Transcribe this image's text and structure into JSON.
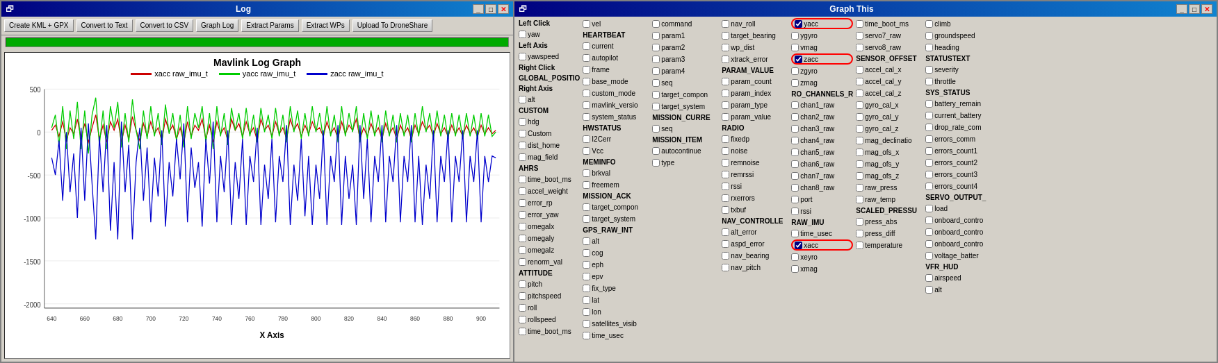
{
  "left_window": {
    "title": "Log",
    "toolbar_buttons": [
      "Create KML + GPX",
      "Convert to Text",
      "Convert to CSV",
      "Graph Log",
      "Extract Params",
      "Extract WPs",
      "Upload To DroneShare"
    ],
    "graph_title": "Mavlink Log Graph",
    "legend": [
      {
        "label": "xacc raw_imu_t",
        "color": "#cc0000"
      },
      {
        "label": "yacc raw_imu_t",
        "color": "#00cc00"
      },
      {
        "label": "zacc raw_imu_t",
        "color": "#0000cc"
      }
    ],
    "y_axis": [
      "500",
      "0",
      "-500",
      "-1000",
      "-1500",
      "-2000"
    ],
    "x_axis": [
      "640",
      "660",
      "680",
      "700",
      "720",
      "740",
      "760",
      "780",
      "800",
      "820",
      "840",
      "860",
      "880",
      "900"
    ],
    "x_label": "X Axis",
    "controls": {
      "minimize": "_",
      "maximize": "□",
      "close": "✕"
    }
  },
  "right_window": {
    "title": "Graph This",
    "controls": {
      "minimize": "_",
      "maximize": "□",
      "close": "✕"
    },
    "row_labels": {
      "left_click": "Left Click",
      "left_axis": "Left Axis",
      "right_click": "Right Click",
      "right_axis": "Right Axis",
      "custom": "CUSTOM",
      "ahrs": "AHRS",
      "attitude": "ATTITUDE",
      "nav_controller": "NAV_CONTROLLE",
      "raw_imu": "RAW_IMU"
    },
    "columns": [
      {
        "header": "",
        "items": [
          {
            "label": "Left Click",
            "header": true
          },
          {
            "label": "yaw",
            "checked": false
          },
          {
            "label": "Left Axis",
            "header": true
          },
          {
            "label": "yawspeed",
            "checked": false
          },
          {
            "label": "Right Click",
            "header": true
          },
          {
            "label": "GLOBAL_POSITIO",
            "header": true
          },
          {
            "label": "Right Axis",
            "header": true
          },
          {
            "label": "alt",
            "checked": false
          },
          {
            "label": "CUSTOM",
            "header": true
          },
          {
            "label": "hdg",
            "checked": false
          },
          {
            "label": "Custom",
            "checked": false
          },
          {
            "label": "dist_home",
            "checked": false
          },
          {
            "label": "mag_field",
            "checked": false
          },
          {
            "label": "AHRS",
            "header": true
          },
          {
            "label": "time_boot_ms",
            "checked": false
          },
          {
            "label": "accel_weight",
            "checked": false
          },
          {
            "label": "error_rp",
            "checked": false
          },
          {
            "label": "error_yaw",
            "checked": false
          },
          {
            "label": "omegaIx",
            "checked": false
          },
          {
            "label": "omegaIy",
            "checked": false
          },
          {
            "label": "omegaIz",
            "checked": false
          },
          {
            "label": "renorm_val",
            "checked": false
          },
          {
            "label": "ATTITUDE",
            "header": true
          },
          {
            "label": "pitch",
            "checked": false
          },
          {
            "label": "pitchspeed",
            "checked": false
          },
          {
            "label": "roll",
            "checked": false
          },
          {
            "label": "rollspeed",
            "checked": false
          },
          {
            "label": "time_boot_ms",
            "checked": false
          }
        ]
      },
      {
        "header": "",
        "items": [
          {
            "label": "vel",
            "checked": false
          },
          {
            "label": "HEARTBEAT",
            "header": true
          },
          {
            "label": "current",
            "checked": false
          },
          {
            "label": "autopilot",
            "checked": false
          },
          {
            "label": "frame",
            "checked": false
          },
          {
            "label": "base_mode",
            "checked": false
          },
          {
            "label": "custom_mode",
            "checked": false
          },
          {
            "label": "mavlink_versio",
            "checked": false
          },
          {
            "label": "system_status",
            "checked": false
          },
          {
            "label": "HWSTATUS",
            "header": true
          },
          {
            "label": "I2Cerr",
            "checked": false
          },
          {
            "label": "Vcc",
            "checked": false
          },
          {
            "label": "MEMINFO",
            "header": true
          },
          {
            "label": "brkval",
            "checked": false
          },
          {
            "label": "freemem",
            "checked": false
          },
          {
            "label": "MISSION_ACK",
            "header": true
          },
          {
            "label": "target_compon",
            "checked": false
          },
          {
            "label": "target_system",
            "checked": false
          },
          {
            "label": "GPS_RAW_INT",
            "header": true
          },
          {
            "label": "alt",
            "checked": false
          },
          {
            "label": "cog",
            "checked": false
          },
          {
            "label": "eph",
            "checked": false
          },
          {
            "label": "epv",
            "checked": false
          },
          {
            "label": "fix_type",
            "checked": false
          },
          {
            "label": "lat",
            "checked": false
          },
          {
            "label": "lon",
            "checked": false
          },
          {
            "label": "satellites_visib",
            "checked": false
          },
          {
            "label": "time_usec",
            "checked": false
          }
        ]
      },
      {
        "header": "",
        "items": [
          {
            "label": "command",
            "checked": false
          },
          {
            "label": "param1",
            "checked": false
          },
          {
            "label": "param2",
            "checked": false
          },
          {
            "label": "param3",
            "checked": false
          },
          {
            "label": "param4",
            "checked": false
          },
          {
            "label": "seq",
            "checked": false
          },
          {
            "label": "target_compon",
            "checked": false
          },
          {
            "label": "target_system",
            "checked": false
          },
          {
            "label": "MISSION_CURRE",
            "header": true
          },
          {
            "label": "seq",
            "checked": false
          },
          {
            "label": "MISSION_ITEM",
            "header": true
          },
          {
            "label": "autocontinue",
            "checked": false
          },
          {
            "label": "type",
            "checked": false
          }
        ]
      },
      {
        "header": "",
        "items": [
          {
            "label": "nav_roll",
            "checked": false
          },
          {
            "label": "target_bearing",
            "checked": false
          },
          {
            "label": "wp_dist",
            "checked": false
          },
          {
            "label": "xtrack_error",
            "checked": false
          },
          {
            "label": "PARAM_VALUE",
            "header": true
          },
          {
            "label": "param_count",
            "checked": false
          },
          {
            "label": "param_index",
            "checked": false
          },
          {
            "label": "param_type",
            "checked": false
          },
          {
            "label": "param_value",
            "checked": false
          },
          {
            "label": "RADIO",
            "header": true
          },
          {
            "label": "fixedp",
            "checked": false
          },
          {
            "label": "noise",
            "checked": false
          },
          {
            "label": "remnoise",
            "checked": false
          },
          {
            "label": "remrssi",
            "checked": false
          },
          {
            "label": "rssi",
            "checked": false
          },
          {
            "label": "rxerrors",
            "checked": false
          },
          {
            "label": "txbuf",
            "checked": false
          },
          {
            "label": "NAV_CONTROLLE",
            "header": true
          },
          {
            "label": "alt_error",
            "checked": false
          },
          {
            "label": "aspd_error",
            "checked": false
          },
          {
            "label": "nav_bearing",
            "checked": false
          },
          {
            "label": "nav_pitch",
            "checked": false
          }
        ]
      },
      {
        "header": "",
        "items": [
          {
            "label": "yacc",
            "checked": true,
            "highlighted": true
          },
          {
            "label": "ygyro",
            "checked": false
          },
          {
            "label": "vmag",
            "checked": false
          },
          {
            "label": "zacc",
            "checked": true,
            "highlighted": true
          },
          {
            "label": "zgyro",
            "checked": false
          },
          {
            "label": "zmag",
            "checked": false
          },
          {
            "label": "RO_CHANNELS_R",
            "header": true
          },
          {
            "label": "chan1_raw",
            "checked": false
          },
          {
            "label": "chan2_raw",
            "checked": false
          },
          {
            "label": "chan3_raw",
            "checked": false
          },
          {
            "label": "chan4_raw",
            "checked": false
          },
          {
            "label": "chan5_raw",
            "checked": false
          },
          {
            "label": "chan6_raw",
            "checked": false
          },
          {
            "label": "chan7_raw",
            "checked": false
          },
          {
            "label": "chan8_raw",
            "checked": false
          },
          {
            "label": "port",
            "checked": false
          },
          {
            "label": "rssi",
            "checked": false
          },
          {
            "label": "RAW_IMU",
            "header": true
          },
          {
            "label": "time_usec",
            "checked": false
          },
          {
            "label": "xacc",
            "checked": true,
            "highlighted": true
          },
          {
            "label": "xeyro",
            "checked": false
          },
          {
            "label": "xmag",
            "checked": false
          }
        ]
      },
      {
        "header": "",
        "items": [
          {
            "label": "time_boot_ms",
            "checked": false
          },
          {
            "label": "servo7_raw",
            "checked": false
          },
          {
            "label": "servo8_raw",
            "checked": false
          },
          {
            "label": "SENSOR_OFFSET",
            "header": true
          },
          {
            "label": "accel_cal_x",
            "checked": false
          },
          {
            "label": "accel_cal_y",
            "checked": false
          },
          {
            "label": "accel_cal_z",
            "checked": false
          },
          {
            "label": "gyro_cal_x",
            "checked": false
          },
          {
            "label": "gyro_cal_y",
            "checked": false
          },
          {
            "label": "gyro_cal_z",
            "checked": false
          },
          {
            "label": "mag_declinatio",
            "checked": false
          },
          {
            "label": "mag_ofs_x",
            "checked": false
          },
          {
            "label": "mag_ofs_y",
            "checked": false
          },
          {
            "label": "mag_ofs_z",
            "checked": false
          },
          {
            "label": "raw_press",
            "checked": false
          },
          {
            "label": "raw_temp",
            "checked": false
          },
          {
            "label": "SCALED_PRESSU",
            "header": true
          },
          {
            "label": "press_abs",
            "checked": false
          },
          {
            "label": "press_diff",
            "checked": false
          },
          {
            "label": "temperature",
            "checked": false
          }
        ]
      },
      {
        "header": "",
        "items": [
          {
            "label": "climb",
            "checked": false
          },
          {
            "label": "groundspeed",
            "checked": false
          },
          {
            "label": "heading",
            "checked": false
          },
          {
            "label": "STATUSTEXT",
            "header": true
          },
          {
            "label": "severity",
            "checked": false
          },
          {
            "label": "throttle",
            "checked": false
          },
          {
            "label": "SYS_STATUS",
            "header": true
          },
          {
            "label": "battery_remain",
            "checked": false
          },
          {
            "label": "current_battery",
            "checked": false
          },
          {
            "label": "drop_rate_com",
            "checked": false
          },
          {
            "label": "errors_comm",
            "checked": false
          },
          {
            "label": "errors_count1",
            "checked": false
          },
          {
            "label": "errors_count2",
            "checked": false
          },
          {
            "label": "errors_count3",
            "checked": false
          },
          {
            "label": "errors_count4",
            "checked": false
          },
          {
            "label": "SERVO_OUTPUT_",
            "header": true
          },
          {
            "label": "load",
            "checked": false
          },
          {
            "label": "onboard_contro",
            "checked": false
          },
          {
            "label": "onboard_contro",
            "checked": false
          },
          {
            "label": "onboard_contro",
            "checked": false
          },
          {
            "label": "voltage_batter",
            "checked": false
          },
          {
            "label": "VFR_HUD",
            "header": true
          },
          {
            "label": "airspeed",
            "checked": false
          },
          {
            "label": "alt",
            "checked": false
          }
        ]
      }
    ]
  }
}
